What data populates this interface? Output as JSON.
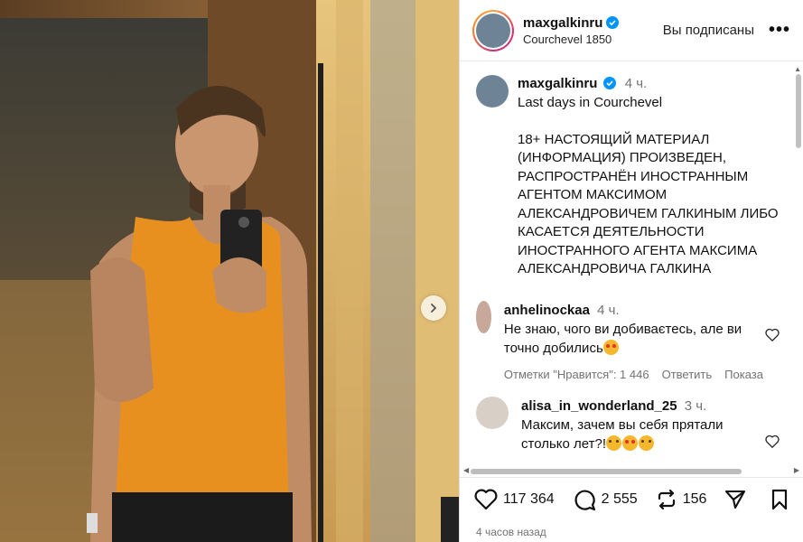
{
  "header": {
    "username": "maxgalkinru",
    "location": "Courchevel 1850",
    "follow_status": "Вы подписаны",
    "more": "•••"
  },
  "caption": {
    "username": "maxgalkinru",
    "time": "4 ч.",
    "text": "Last days in Courchevel\n\n18+ НАСТОЯЩИЙ МАТЕРИАЛ (ИНФОРМАЦИЯ)  ПРОИЗВЕДЕН, РАСПРОСТРАНЁН ИНОСТРАННЫМ АГЕНТОМ МАКСИМОМ АЛЕКСАНДРОВИЧЕМ ГАЛКИНЫМ ЛИБО КАСАЕТСЯ ДЕЯТЕЛЬНОСТИ ИНОСТРАННОГО АГЕНТА МАКСИМА АЛЕКСАНДРОВИЧА ГАЛКИНА"
  },
  "comments": [
    {
      "username": "anhelinockaa",
      "time": "4 ч.",
      "text": "Не знаю, чого ви добиваєтесь, але ви точно добились",
      "likes": "Отметки \"Нравится\": 1 446",
      "reply": "Ответить",
      "show": "Показа"
    },
    {
      "username": "alisa_in_wonderland_25",
      "time": "3 ч.",
      "text": "Максим, зачем вы себя прятали столько лет?!"
    }
  ],
  "actions": {
    "likes": "117 364",
    "comments": "2 555",
    "reposts": "156"
  },
  "post_time": "4 часов назад",
  "colors": {
    "verified": "#0095f6",
    "shirt": "#e8901f",
    "meta_gray": "#737373"
  }
}
